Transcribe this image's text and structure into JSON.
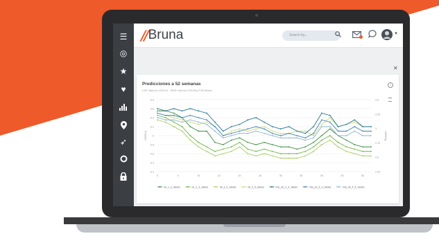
{
  "colors": {
    "accent": "#ee5a2a",
    "sidebar": "#3b3f44"
  },
  "header": {
    "logo_text": "Bruna",
    "search_placeholder": "Search by...",
    "icons": [
      "search-icon",
      "mail-icon",
      "chat-icon",
      "avatar"
    ]
  },
  "sidebar": {
    "items": [
      {
        "icon": "menu-icon"
      },
      {
        "icon": "target-icon"
      },
      {
        "icon": "star-icon"
      },
      {
        "icon": "heart-icon"
      },
      {
        "icon": "bar-chart-icon"
      },
      {
        "icon": "location-pin-icon"
      },
      {
        "icon": "send-icon"
      },
      {
        "icon": "circle-icon"
      },
      {
        "icon": "lock-icon"
      }
    ]
  },
  "card": {
    "title": "Predicciones a 52 semanas",
    "subtitle": "LSE Valores USD/Lb - RMR Valores USD/Kg FOB Miami"
  },
  "chart_data": {
    "type": "line",
    "x": [
      0,
      2,
      4,
      6,
      8,
      10,
      12,
      14,
      16,
      18,
      20,
      22,
      24,
      26,
      28,
      30,
      32,
      34,
      36,
      38,
      40,
      42,
      44,
      46,
      48,
      50,
      52
    ],
    "xticks": [
      0,
      5,
      10,
      15,
      20,
      25,
      30,
      35,
      40,
      45,
      50
    ],
    "yleft_ticks": [
      "5.2",
      "5.4",
      "5.6",
      "5.8",
      "6",
      "6.2",
      "6.4",
      "6.6",
      "6.8"
    ],
    "yright_ticks": [
      "2.25",
      "2.5",
      "2.75",
      "3",
      "3.25",
      "3.5"
    ],
    "ylabel_left": "USD/Lb",
    "ylabel_right": "USD/Kg",
    "ylim": [
      5.2,
      6.8
    ],
    "legend_position": "bottom",
    "series": [
      {
        "name": "ub_1_2_values",
        "color": "#3a8c3f",
        "values": [
          6.55,
          6.55,
          6.5,
          6.4,
          6.2,
          6.1,
          6.1,
          5.85,
          5.8,
          5.9,
          5.95,
          5.85,
          5.8,
          5.85,
          5.8,
          5.75,
          5.75,
          5.7,
          5.75,
          5.85,
          6.0,
          6.15,
          6.0,
          5.9,
          5.8,
          5.75,
          5.75
        ]
      },
      {
        "name": "ub_2_3_values",
        "color": "#6cb33f",
        "values": [
          6.45,
          6.4,
          6.3,
          6.2,
          6.0,
          5.85,
          5.75,
          5.65,
          5.7,
          5.75,
          5.85,
          5.7,
          5.65,
          5.7,
          5.65,
          5.6,
          5.6,
          5.6,
          5.65,
          5.75,
          5.9,
          6.0,
          5.85,
          5.75,
          5.7,
          5.65,
          5.65
        ]
      },
      {
        "name": "ub_3_4_values",
        "color": "#a4cc5a",
        "values": [
          6.35,
          6.3,
          6.2,
          6.1,
          5.9,
          5.75,
          5.65,
          5.55,
          5.6,
          5.65,
          5.75,
          5.6,
          5.55,
          5.6,
          5.55,
          5.5,
          5.5,
          5.5,
          5.55,
          5.65,
          5.8,
          5.9,
          5.75,
          5.65,
          5.6,
          5.55,
          5.55
        ]
      },
      {
        "name": "ub_4_5_values",
        "color": "#c8d97a",
        "values": [
          6.5,
          6.45,
          6.4,
          6.35,
          6.3,
          6.25,
          6.3,
          6.2,
          6.0,
          6.1,
          6.15,
          6.1,
          6.15,
          6.2,
          6.1,
          6.05,
          6.05,
          6.1,
          6.1,
          6.0,
          6.25,
          6.4,
          6.2,
          6.25,
          6.3,
          6.2,
          6.2
        ]
      },
      {
        "name": "rmp_ub_2_3_values",
        "color": "#1f6f8b",
        "values": [
          6.6,
          6.55,
          6.6,
          6.55,
          6.6,
          6.55,
          6.5,
          6.3,
          6.1,
          6.2,
          6.25,
          6.35,
          6.4,
          6.3,
          6.2,
          6.15,
          6.2,
          6.1,
          6.05,
          6.2,
          6.5,
          6.45,
          6.2,
          6.25,
          6.35,
          6.2,
          6.2
        ]
      },
      {
        "name": "rmp_ub_3_4_values",
        "color": "#3b7fb3",
        "values": [
          6.5,
          6.45,
          6.45,
          6.4,
          6.45,
          6.4,
          6.35,
          6.2,
          6.0,
          6.05,
          6.1,
          6.15,
          6.2,
          6.15,
          6.05,
          6.0,
          6.05,
          6.0,
          5.95,
          6.05,
          6.35,
          6.3,
          6.1,
          6.1,
          6.2,
          6.1,
          6.1
        ]
      },
      {
        "name": "rmp_ub_4_5_values",
        "color": "#8fb3cc",
        "values": [
          6.4,
          6.35,
          6.35,
          6.3,
          6.35,
          6.3,
          6.25,
          6.1,
          5.95,
          6.0,
          6.05,
          6.05,
          6.1,
          6.05,
          6.0,
          5.95,
          5.95,
          5.95,
          5.9,
          5.95,
          6.2,
          6.2,
          6.0,
          6.0,
          6.1,
          6.0,
          6.0
        ]
      }
    ]
  }
}
